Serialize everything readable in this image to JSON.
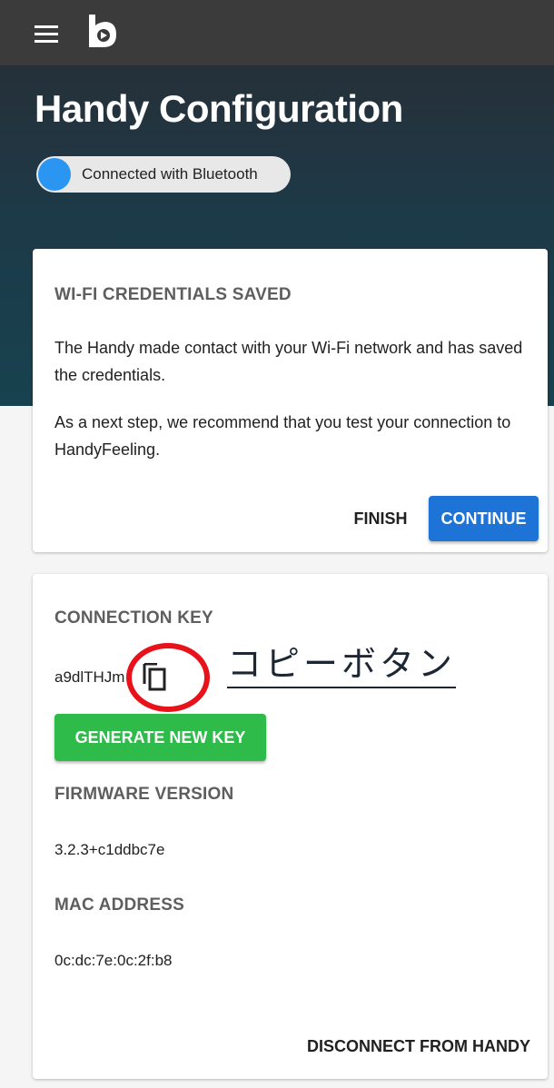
{
  "header": {
    "menu_icon": "hamburger-menu-icon",
    "logo_icon": "handy-logo-icon"
  },
  "hero": {
    "title": "Handy Configuration",
    "bluetooth_toggle": {
      "label": "Connected with Bluetooth",
      "state": "on",
      "knob_color": "#2b95f2"
    }
  },
  "wifi_card": {
    "heading": "WI-FI CREDENTIALS SAVED",
    "paragraph1": "The Handy made contact with your Wi-Fi network and has saved the credentials.",
    "paragraph2": "As a next step, we recommend that you test your connection to HandyFeeling.",
    "finish_label": "FINISH",
    "continue_label": "CONTINUE"
  },
  "info_card": {
    "connection_key_heading": "CONNECTION KEY",
    "connection_key_value": "a9dlTHJm",
    "copy_icon": "copy-icon",
    "annotation_label": "コピーボタン",
    "generate_label": "GENERATE NEW KEY",
    "firmware_heading": "FIRMWARE VERSION",
    "firmware_value": "3.2.3+c1ddbc7e",
    "mac_heading": "MAC ADDRESS",
    "mac_value": "0c:dc:7e:0c:2f:b8",
    "disconnect_label": "DISCONNECT FROM HANDY"
  },
  "colors": {
    "topbar": "#3b3b3b",
    "hero_top": "#263039",
    "hero_bottom": "#17424f",
    "continue_button": "#1e74d6",
    "generate_button": "#2ebb4a",
    "highlight_circle": "#e8121b"
  }
}
